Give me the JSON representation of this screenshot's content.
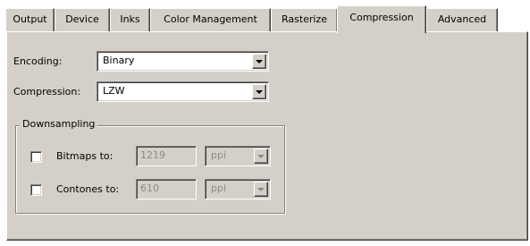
{
  "tabs": [
    {
      "label": "Output",
      "active": false
    },
    {
      "label": "Device",
      "active": false
    },
    {
      "label": "Inks",
      "active": false
    },
    {
      "label": "Color Management",
      "active": false
    },
    {
      "label": "Rasterize",
      "active": false
    },
    {
      "label": "Compression",
      "active": true
    },
    {
      "label": "Advanced",
      "active": false
    }
  ],
  "encoding": {
    "label": "Encoding:",
    "value": "Binary"
  },
  "compression": {
    "label": "Compression:",
    "value": "LZW"
  },
  "downsampling": {
    "title": "Downsampling",
    "bitmaps": {
      "label": "Bitmaps to:",
      "checked": false,
      "value": "1219",
      "unit": "ppi"
    },
    "contones": {
      "label": "Contones to:",
      "checked": false,
      "value": "610",
      "unit": "ppi"
    }
  },
  "colors": {
    "face": "#d4d0c8",
    "disabled_text": "#8c8a86"
  }
}
